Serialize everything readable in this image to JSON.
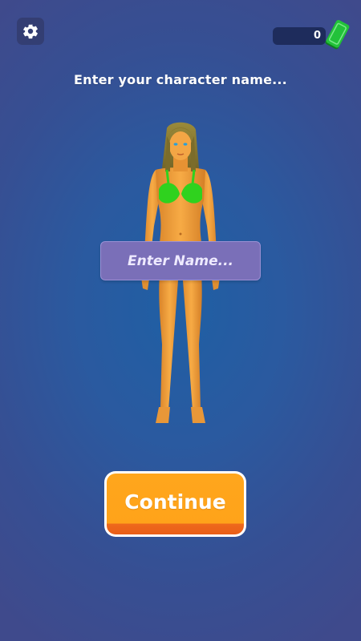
{
  "header": {
    "currency_amount": "0"
  },
  "title": "Enter your character name...",
  "name_input": {
    "placeholder": "Enter Name..."
  },
  "continue_label": "Continue",
  "icons": {
    "settings": "gear-icon",
    "currency": "cash-icon"
  },
  "colors": {
    "background": "#2a5aa0",
    "input_bg": "#7a6fb8",
    "button": "#ffa31a",
    "button_edge": "#e95e18",
    "cash": "#22c23a",
    "bikini": "#2fd21e",
    "skin": "#f0a33b"
  }
}
